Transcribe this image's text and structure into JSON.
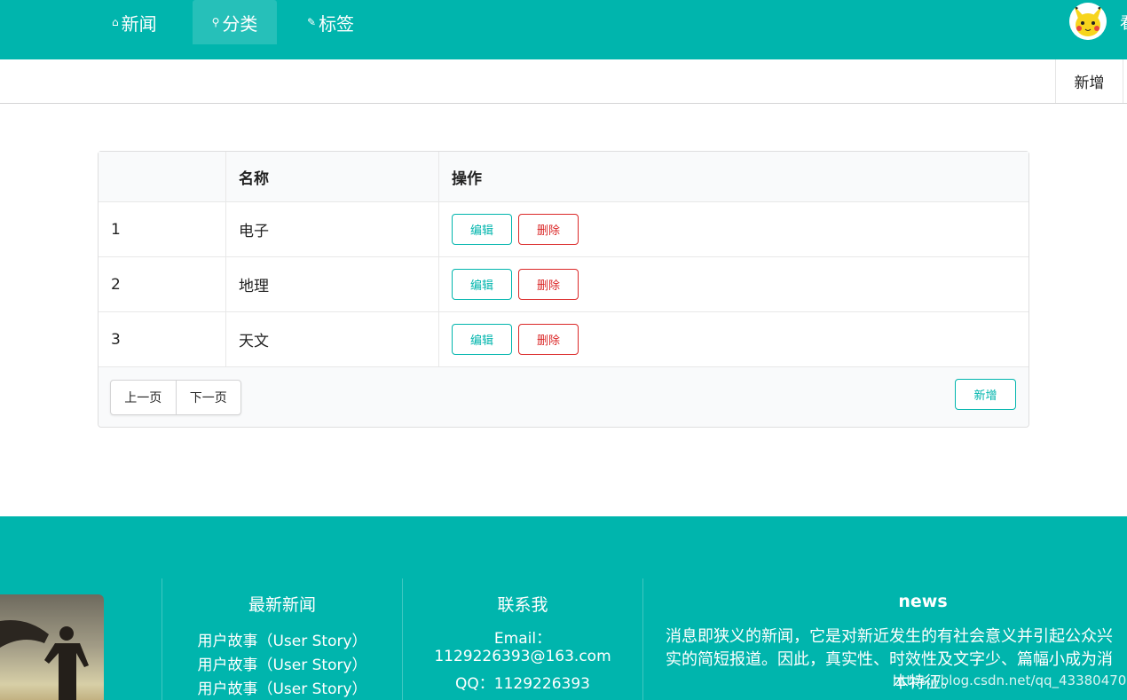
{
  "nav": {
    "items": [
      {
        "icon": "home-icon",
        "glyph": "⌂",
        "label": "新闻"
      },
      {
        "icon": "pin-icon",
        "glyph": "⚲",
        "label": "分类"
      },
      {
        "icon": "tag-icon",
        "glyph": "✎",
        "label": "标签"
      }
    ],
    "user_partial": "看"
  },
  "toolbar": {
    "add_label": "新增"
  },
  "table": {
    "headers": [
      "",
      "名称",
      "操作"
    ],
    "rows": [
      {
        "id": "1",
        "name": "电子"
      },
      {
        "id": "2",
        "name": "地理"
      },
      {
        "id": "3",
        "name": "天文"
      }
    ],
    "edit_label": "编辑",
    "delete_label": "删除",
    "prev_label": "上一页",
    "next_label": "下一页",
    "add_label": "新增"
  },
  "footer": {
    "latest": {
      "title": "最新新闻",
      "items": [
        "用户故事（User Story）",
        "用户故事（User Story）",
        "用户故事（User Story）"
      ]
    },
    "contact": {
      "title": "联系我",
      "email_label": "Email：",
      "email": "1129226393@163.com",
      "qq": "QQ：1129226393"
    },
    "news": {
      "title": "news",
      "line1": "消息即狭义的新闻，它是对新近发生的有社会意义并引起公众兴",
      "line2": "实的简短报道。因此，真实性、时效性及文字少、篇幅小成为消",
      "line3": "本特征。"
    },
    "watermark": "https://blog.csdn.net/qq_43380470"
  },
  "colors": {
    "primary": "#00b5ad",
    "danger": "#db2828"
  }
}
